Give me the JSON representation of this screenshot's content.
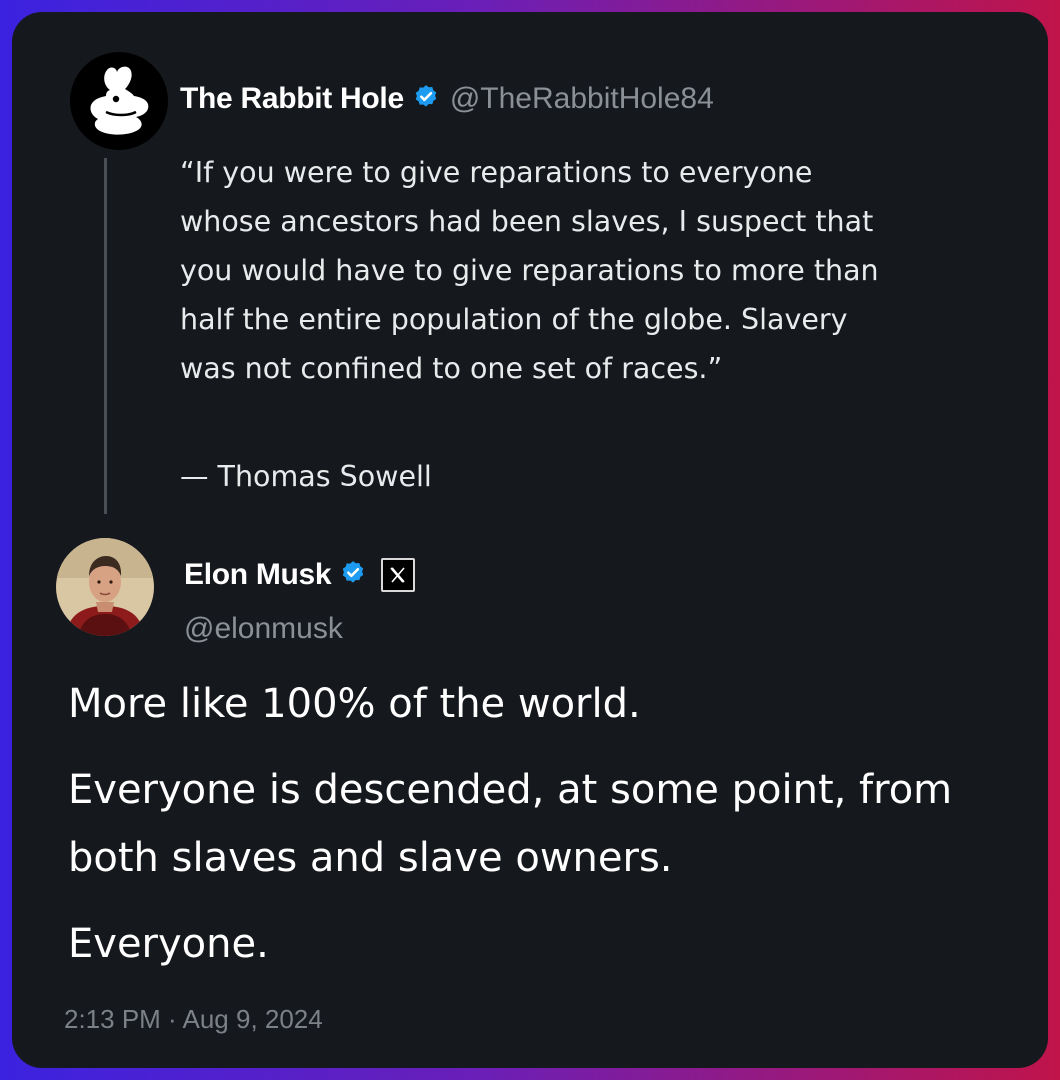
{
  "quoted_post": {
    "author_name": "The Rabbit Hole",
    "handle": "@TheRabbitHole84",
    "text": "“If you were to give reparations to everyone whose ancestors had been slaves, I suspect that you would have to give reparations to more than half the entire population of the globe. Slavery was not confined to one set of races.”",
    "attribution": "— Thomas Sowell",
    "avatar_icon": "rabbit-icon",
    "verified_icon": "verified-badge-icon"
  },
  "post": {
    "author_name": "Elon Musk",
    "handle": "@elonmusk",
    "affiliate_icon": "x-logo-icon",
    "verified_icon": "verified-badge-icon",
    "paragraphs": [
      "More like 100% of the world.",
      "Everyone is descended, at some point, from both slaves and slave owners.",
      "Everyone."
    ],
    "timestamp": "2:13 PM · Aug 9, 2024"
  },
  "colors": {
    "card_background": "#15181d",
    "verified_blue": "#1d9bf0",
    "secondary_text": "#8b9097",
    "frame_gradient_left": "#3b22e0",
    "frame_gradient_right": "#c0144a"
  }
}
